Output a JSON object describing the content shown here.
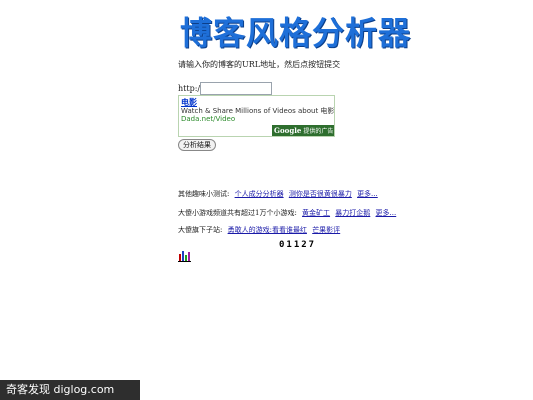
{
  "header": {
    "title": "博客风格分析器"
  },
  "form": {
    "instruction": "请输入你的博客的URL地址，然后点按钮提交",
    "url_label": "http://",
    "url_value": "",
    "submit_label": "分析结果"
  },
  "ad": {
    "title": "电影",
    "description": "Watch & Share Millions of Videos about 电影",
    "url": "Dada.net/Video",
    "provider_logo": "Google",
    "provider_text": "提供的广告"
  },
  "links": {
    "row1": {
      "label": "其他趣味小测试:",
      "items": [
        "个人成分分析器",
        "测你是否很黄很暴力",
        "更多..."
      ]
    },
    "row2": {
      "label": "大傻小游戏频道共有超过1万个小游戏:",
      "items": [
        "黄金矿工",
        "暴力打企鹅",
        "更多..."
      ]
    },
    "row3": {
      "label": "大傻旗下子站:",
      "items": [
        "勇敢人的游戏:看看谁最红",
        "芒果影评"
      ]
    }
  },
  "counter": {
    "value": "01127"
  },
  "watermark": {
    "text": "奇客发现 diglog.com"
  },
  "colors": {
    "title": "#1e6fd8",
    "link": "#1a1aa8",
    "ad_green": "#2e6e2e"
  }
}
